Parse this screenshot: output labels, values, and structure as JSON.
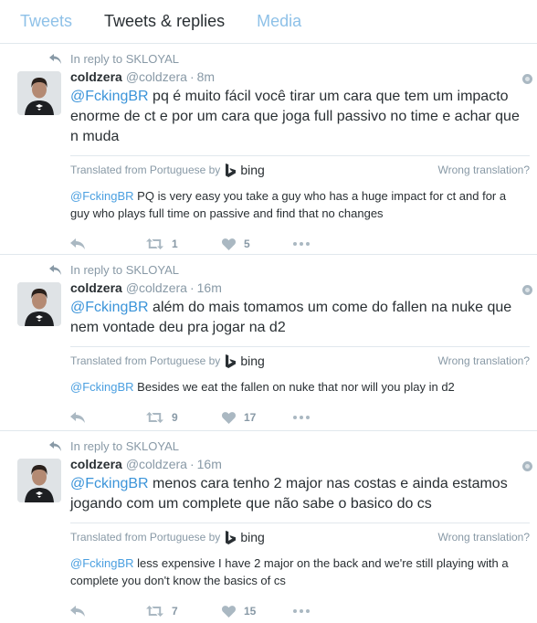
{
  "tabs": [
    "Tweets",
    "Tweets & replies",
    "Media"
  ],
  "translation": {
    "from_label": "Translated from Portuguese by",
    "provider": "bing",
    "wrong_label": "Wrong translation?"
  },
  "tweets": [
    {
      "context": "In reply to SKLOYAL",
      "name": "coldzera",
      "handle": "@coldzera",
      "time": "8m",
      "mention": "@FckingBR",
      "text": "pq é muito fácil você tirar um cara que tem um impacto enorme de ct e por um cara que joga full passivo no time e achar que n muda",
      "translation": "PQ is very easy you take a guy who has a huge impact for ct and for a guy who plays full time on passive and find that no changes",
      "retweets": "1",
      "likes": "5"
    },
    {
      "context": "In reply to SKLOYAL",
      "name": "coldzera",
      "handle": "@coldzera",
      "time": "16m",
      "mention": "@FckingBR",
      "text": "além do mais tomamos um come do fallen na nuke que nem vontade deu pra jogar na d2",
      "translation": "Besides we eat the fallen on nuke that nor will you play in d2",
      "retweets": "9",
      "likes": "17"
    },
    {
      "context": "In reply to SKLOYAL",
      "name": "coldzera",
      "handle": "@coldzera",
      "time": "16m",
      "mention": "@FckingBR",
      "text": "menos cara tenho 2 major nas costas e ainda estamos jogando com um complete que não sabe o basico do cs",
      "translation": "less expensive I have 2 major on the back and we're still playing with a complete you don't know the basics of cs",
      "retweets": "7",
      "likes": "15"
    }
  ]
}
